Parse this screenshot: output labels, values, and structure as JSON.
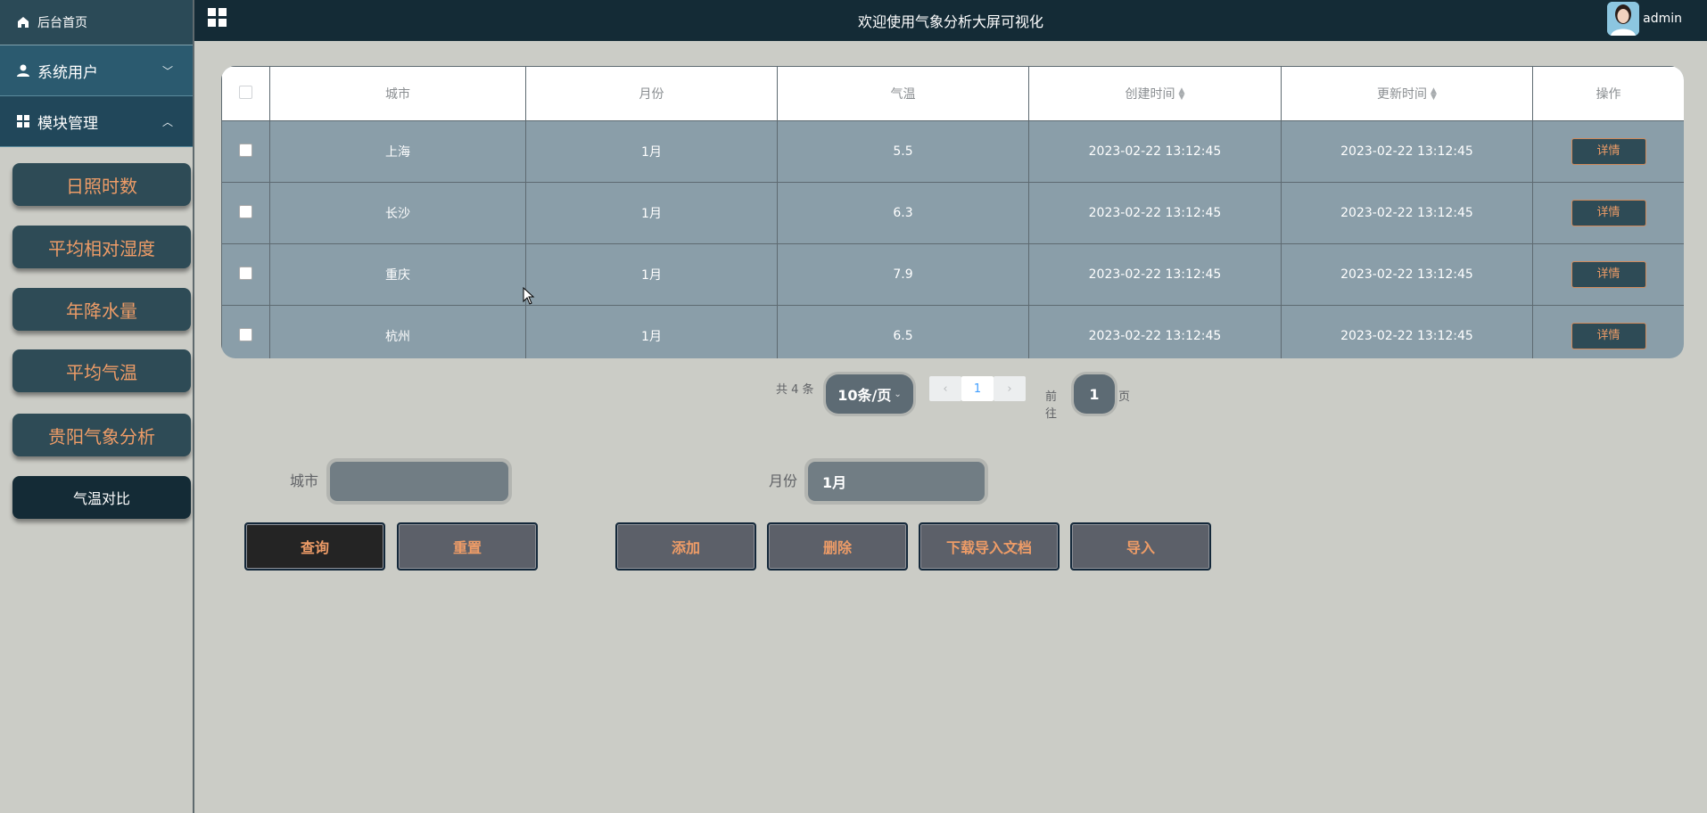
{
  "header": {
    "title": "欢迎使用气象分析大屏可视化",
    "user": "admin"
  },
  "sidebar": {
    "home": "后台首页",
    "groups": [
      {
        "label": "系统用户"
      },
      {
        "label": "模块管理"
      }
    ],
    "items": [
      {
        "label": "日照时数"
      },
      {
        "label": "平均相对湿度"
      },
      {
        "label": "年降水量"
      },
      {
        "label": "平均气温"
      },
      {
        "label": "贵阳气象分析"
      },
      {
        "label": "气温对比"
      }
    ]
  },
  "table": {
    "columns": [
      "城市",
      "月份",
      "气温",
      "创建时间",
      "更新时间",
      "操作"
    ],
    "detail_label": "详情",
    "rows": [
      {
        "city": "上海",
        "month": "1月",
        "temp": "5.5",
        "created": "2023-02-22 13:12:45",
        "updated": "2023-02-22 13:12:45"
      },
      {
        "city": "长沙",
        "month": "1月",
        "temp": "6.3",
        "created": "2023-02-22 13:12:45",
        "updated": "2023-02-22 13:12:45"
      },
      {
        "city": "重庆",
        "month": "1月",
        "temp": "7.9",
        "created": "2023-02-22 13:12:45",
        "updated": "2023-02-22 13:12:45"
      },
      {
        "city": "杭州",
        "month": "1月",
        "temp": "6.5",
        "created": "2023-02-22 13:12:45",
        "updated": "2023-02-22 13:12:45"
      }
    ]
  },
  "pager": {
    "total": "共 4 条",
    "page_size": "10条/页",
    "prev": "‹",
    "current": "1",
    "next": "›",
    "goto_label": "前往",
    "goto_value": "1",
    "page_suffix": "页"
  },
  "form": {
    "city_label": "城市",
    "city_value": "",
    "month_label": "月份",
    "month_value": "1月"
  },
  "actions": {
    "query": "查询",
    "reset": "重置",
    "add": "添加",
    "delete": "删除",
    "download": "下载导入文档",
    "import": "导入"
  }
}
